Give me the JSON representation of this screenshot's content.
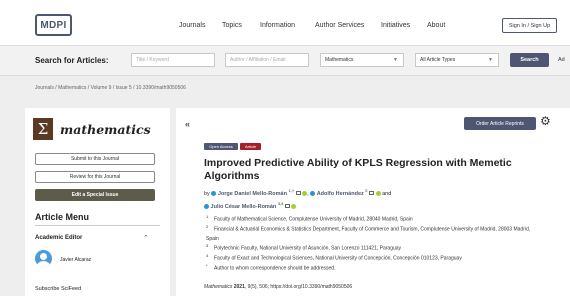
{
  "header": {
    "logo_text": "MDPI",
    "nav": [
      "Journals",
      "Topics",
      "Information",
      "Author Services",
      "Initiatives",
      "About"
    ],
    "sign_in": "Sign In / Sign Up"
  },
  "search": {
    "label": "Search for Articles:",
    "keyword_placeholder": "Title / Keyword",
    "author_placeholder": "Author / Affiliation / Email",
    "journal_value": "Mathematics",
    "type_value": "All Article Types",
    "button": "Search",
    "advanced": "Ad"
  },
  "breadcrumb": "Journals / Mathematics / Volume 9 / Issue 5 / 10.3390/math9050506",
  "sidebar": {
    "journal_logo_symbol": "Σ",
    "journal_name": "mathematics",
    "submit": "Submit to this Journal",
    "review": "Review for this Journal",
    "special_issue": "Edit a Special Issue",
    "menu_title": "Article Menu",
    "editor_label": "Academic Editor",
    "editor_name": "Javier Alcaraz",
    "subscribe": "Subscribe SciFeed"
  },
  "article": {
    "collapse_icon": "«",
    "order_reprints": "Order Article Reprints",
    "badge_open_access": "Open Access",
    "badge_type": "Article",
    "title": "Improved Predictive Ability of KPLS Regression with Memetic Algorithms",
    "by": "by",
    "authors": [
      {
        "name": "Jorge Daniel Mello-Román",
        "sup": "1,†"
      },
      {
        "name": "Adolfo Hernández",
        "sup": "2"
      },
      {
        "name": "Julio César Mello-Román",
        "sup": "3,4"
      }
    ],
    "and": "and",
    "affiliations": [
      {
        "num": "1",
        "text": "Faculty of Mathematical Science, Complutense University of Madrid, 28040 Madrid, Spain"
      },
      {
        "num": "2",
        "text": "Financial & Actuarial Economics & Statistics Department, Faculty of Commerce and Tourism, Complutense University of Madrid, 28003 Madrid, Spain"
      },
      {
        "num": "3",
        "text": "Polytechnic Faculty, National University of Asunción, San Lorenzo 111421, Paraguay"
      },
      {
        "num": "4",
        "text": "Faculty of Exact and Technological Sciences, National University of Concepción, Concepción 010123, Paraguay"
      },
      {
        "num": "*",
        "text": "Author to whom correspondence should be addressed."
      }
    ],
    "citation_journal": "Mathematics",
    "citation_year": "2021",
    "citation_rest": ", 9(5), 506; https://doi.org/10.3390/math9050506"
  }
}
